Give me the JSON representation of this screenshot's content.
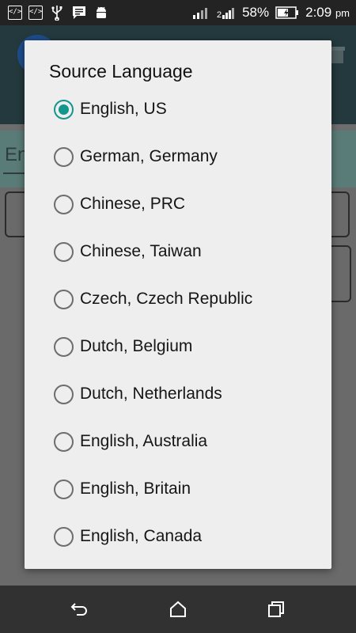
{
  "status_bar": {
    "battery": "58%",
    "time": "2:09",
    "ampm": "pm",
    "left_icons": [
      "code-icon",
      "code-icon",
      "usb-icon",
      "message-icon",
      "android-icon"
    ],
    "right_icons": [
      "signal-icon",
      "signal-2-icon",
      "battery-icon"
    ]
  },
  "background": {
    "input_hint": "En"
  },
  "dialog": {
    "title": "Source Language",
    "accent_color": "#14968c",
    "options": [
      {
        "label": "English, US",
        "checked": true
      },
      {
        "label": "German, Germany",
        "checked": false
      },
      {
        "label": "Chinese, PRC",
        "checked": false
      },
      {
        "label": "Chinese, Taiwan",
        "checked": false
      },
      {
        "label": "Czech, Czech Republic",
        "checked": false
      },
      {
        "label": "Dutch, Belgium",
        "checked": false
      },
      {
        "label": "Dutch, Netherlands",
        "checked": false
      },
      {
        "label": "English, Australia",
        "checked": false
      },
      {
        "label": "English, Britain",
        "checked": false
      },
      {
        "label": "English, Canada",
        "checked": false
      }
    ]
  },
  "nav_bar": {
    "buttons": [
      "back-icon",
      "home-icon",
      "recents-icon"
    ]
  }
}
